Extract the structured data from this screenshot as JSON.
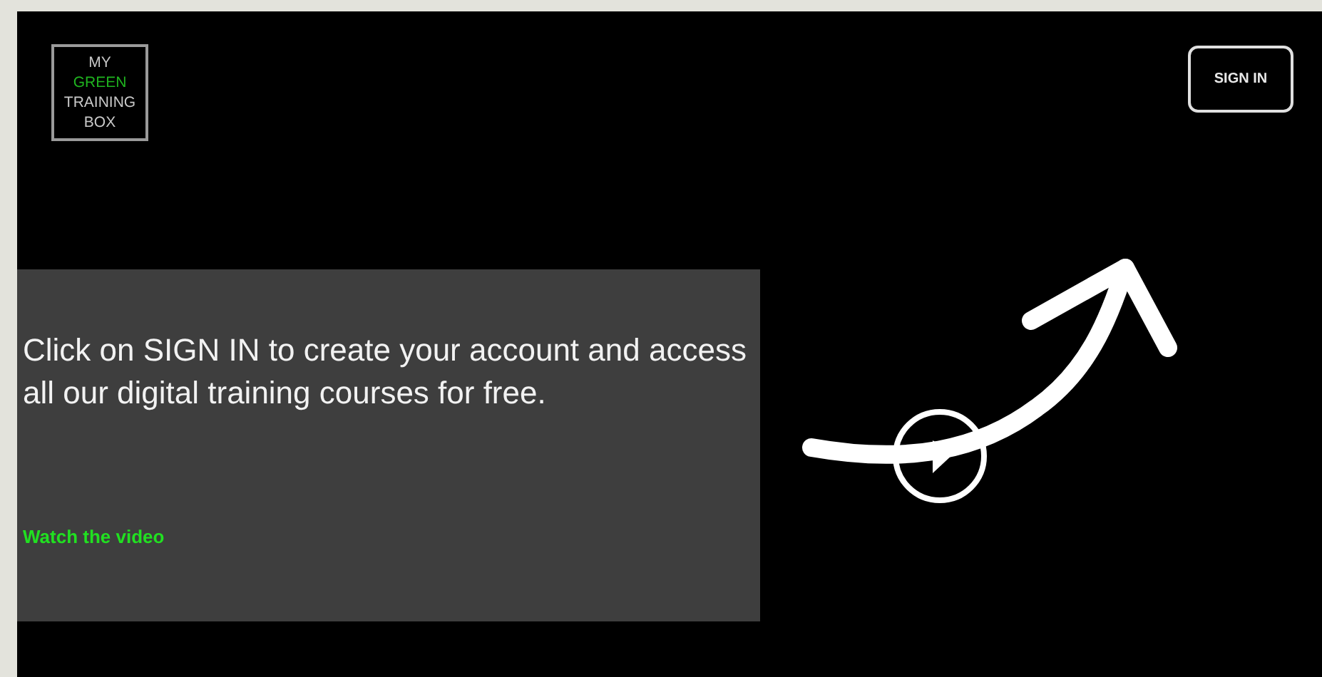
{
  "logo": {
    "lines": [
      {
        "text": "MY",
        "highlight": false
      },
      {
        "text": "GREEN",
        "highlight": true
      },
      {
        "text": "TRAINING",
        "highlight": false
      },
      {
        "text": "BOX",
        "highlight": false
      }
    ]
  },
  "header": {
    "button": "SIGN IN"
  },
  "panel": {
    "message": "Click on SIGN IN to create your account and access all our digital training courses for free.",
    "link": "Watch the video"
  }
}
